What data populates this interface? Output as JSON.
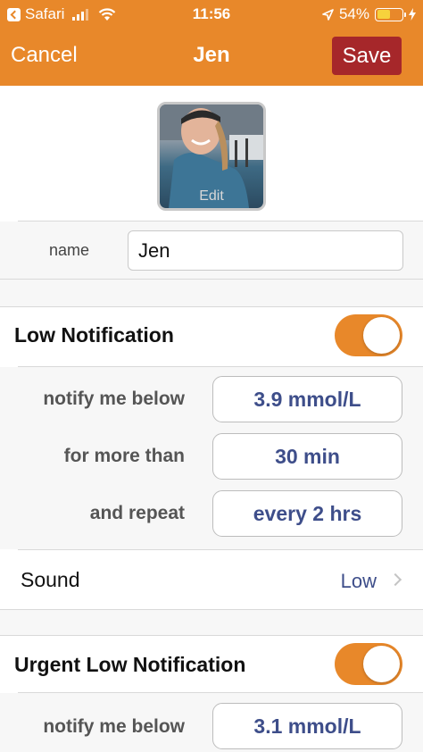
{
  "status_bar": {
    "back_app": "Safari",
    "time": "11:56",
    "battery_percent": "54%",
    "battery_level": 0.54
  },
  "nav": {
    "cancel_label": "Cancel",
    "title": "Jen",
    "save_label": "Save"
  },
  "avatar": {
    "edit_label": "Edit"
  },
  "name_field": {
    "label": "name",
    "value": "Jen"
  },
  "low_notification": {
    "title": "Low Notification",
    "enabled": true,
    "rows": [
      {
        "label": "notify me below",
        "value": "3.9 mmol/L"
      },
      {
        "label": "for more than",
        "value": "30 min"
      },
      {
        "label": "and repeat",
        "value": "every 2 hrs"
      }
    ],
    "sound": {
      "label": "Sound",
      "value": "Low"
    }
  },
  "urgent_low_notification": {
    "title": "Urgent Low Notification",
    "enabled": true,
    "rows": [
      {
        "label": "notify me below",
        "value": "3.1 mmol/L"
      }
    ]
  },
  "colors": {
    "accent": "#e8882a",
    "save_button": "#a6272a",
    "value_text": "#3e4e8a"
  }
}
